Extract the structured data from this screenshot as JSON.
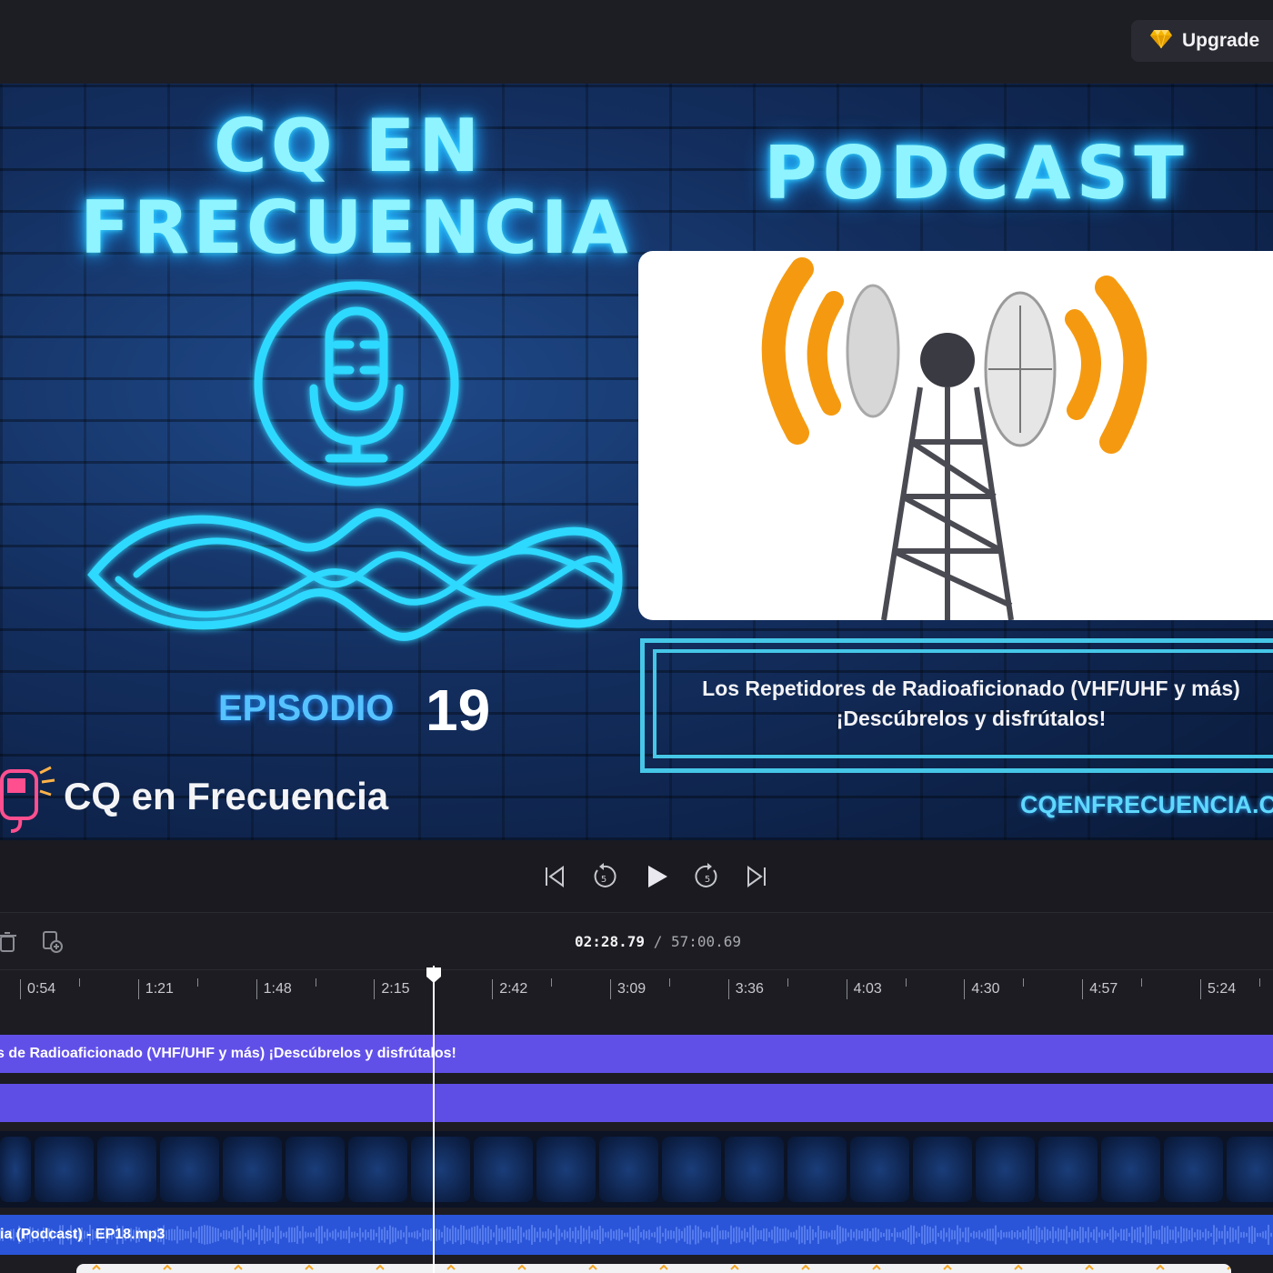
{
  "header": {
    "upgrade_label": "Upgrade",
    "upgrade_icon": "diamond-icon"
  },
  "preview": {
    "title_line1": "CQ EN",
    "title_line2": "FRECUENCIA",
    "podcast_label": "PODCAST",
    "episode_label": "EPISODIO",
    "episode_number": "19",
    "episode_title": "Los Repetidores de Radioaficionado (VHF/UHF y más) ¡Descúbrelos y disfrútalos!",
    "brand_name": "CQ en Frecuencia",
    "website": "CQENFRECUENCIA.CO"
  },
  "transport": {
    "buttons": [
      "skip-to-start",
      "rewind-5",
      "play",
      "forward-5",
      "skip-to-end"
    ],
    "skip_seconds": "5"
  },
  "timeline": {
    "current_time": "02:28.79",
    "separator": " / ",
    "total_time": "57:00.69",
    "ruler_labels": [
      "0:54",
      "1:21",
      "1:48",
      "2:15",
      "2:42",
      "3:09",
      "3:36",
      "4:03",
      "4:30",
      "4:57",
      "5:24"
    ],
    "tracks": {
      "title_text": "s de Radioaficionado (VHF/UHF y más) ¡Descúbrelos y disfrútalos!",
      "audio_text": "ia (Podcast) - EP18.mp3"
    }
  },
  "colors": {
    "accent_purple": "#6150e8",
    "audio_blue": "#2a55d8",
    "neon_cyan": "#8ff4ff",
    "upgrade_gold": "#f5b400"
  }
}
